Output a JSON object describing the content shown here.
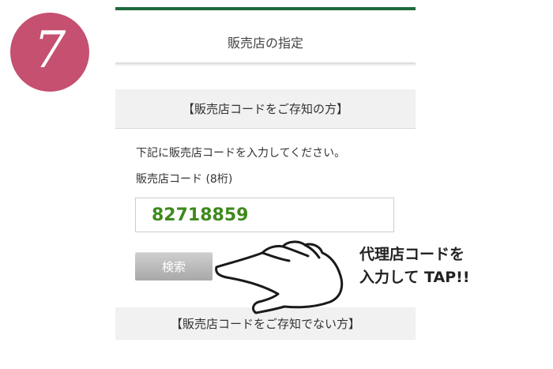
{
  "step": {
    "number": "7",
    "badge_color": "#c5506f"
  },
  "page": {
    "title": "販売店の指定",
    "accent_color": "#1e6a3c"
  },
  "section_known": {
    "heading": "【販売店コードをご存知の方】"
  },
  "form": {
    "instruction": "下記に販売店コードを入力してください。",
    "code_label": "販売店コード (8桁)",
    "code_value": "82718859",
    "search_button": "検索"
  },
  "section_unknown": {
    "heading": "【販売店コードをご存知でない方】"
  },
  "callout": {
    "line1": "代理店コードを",
    "line2": "入力して TAP!!",
    "icon": "pointing-hand-icon"
  }
}
